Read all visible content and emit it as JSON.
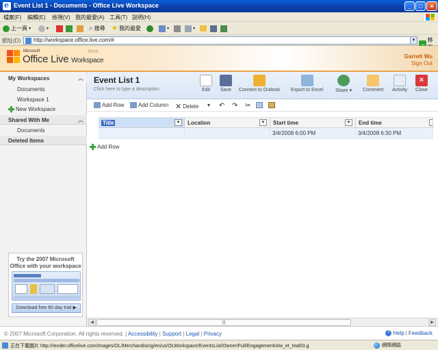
{
  "window": {
    "title": "Event List 1 - Documents - Office Live Workspace"
  },
  "menu": [
    "檔案(F)",
    "編輯(E)",
    "檢視(V)",
    "我的最愛(A)",
    "工具(T)",
    "說明(H)"
  ],
  "toolbar": {
    "back": "上一頁",
    "search": "搜尋",
    "favorites": "我的最愛"
  },
  "address": {
    "label": "網址(D)",
    "url": "http://workspace.office.live.com/#",
    "go": "移至"
  },
  "brand": {
    "microsoft": "Microsoft",
    "office_live": "Office Live",
    "workspace": "Workspace",
    "beta": "Beta",
    "user": "Garrett Wu",
    "signout": "Sign Out"
  },
  "sidebar": {
    "my_workspaces": "My Workspaces",
    "documents": "Documents",
    "workspace1": "Workspace 1",
    "new_workspace": "New Workspace",
    "shared_with_me": "Shared With Me",
    "shared_documents": "Documents",
    "deleted_items": "Deleted Items",
    "promo_title": "Try the 2007 Microsoft Office with your workspace",
    "promo_button": "Download free 60 day trial"
  },
  "list": {
    "title": "Event List 1",
    "description": "Click here to type a description.",
    "commands": [
      {
        "label": "Edit",
        "icon": "edit-icon"
      },
      {
        "label": "Save",
        "icon": "save-icon"
      },
      {
        "label": "Connect to Outlook",
        "icon": "outlook-icon"
      },
      {
        "label": "Export to Excel",
        "icon": "excel-icon"
      },
      {
        "label": "Share",
        "icon": "share-icon"
      },
      {
        "label": "Comment",
        "icon": "comment-icon"
      },
      {
        "label": "Activity",
        "icon": "activity-icon"
      },
      {
        "label": "Close",
        "icon": "close-icon"
      }
    ],
    "actions": {
      "add_row": "Add Row",
      "add_column": "Add Column",
      "delete": "Delete"
    },
    "columns": [
      "Title",
      "Location",
      "Start time",
      "End time"
    ],
    "rows": [
      {
        "title": "",
        "location": "",
        "start": "3/4/2008 6:00 PM",
        "end": "3/4/2008 6:30 PM"
      }
    ],
    "add_row_bottom": "Add Row"
  },
  "footer": {
    "copyright": "© 2007 Microsoft Corporation. All rights reserved.",
    "accessibility": "Accessibility",
    "support": "Support",
    "legal": "Legal",
    "privacy": "Privacy",
    "help": "Help",
    "feedback": "Feedback"
  },
  "status": {
    "text": "正在下載圖片 http://render.officelive.com/Images/OL/Merchandising/en/us/OLWorkspace/EventsList/Owner/Full/Engagement/olw_et_trial03.g",
    "zone": "網際網路"
  },
  "colors": {
    "accent": "#e9a24a",
    "titlebar": "#0b3fa8",
    "selection": "#3a6cc0"
  }
}
